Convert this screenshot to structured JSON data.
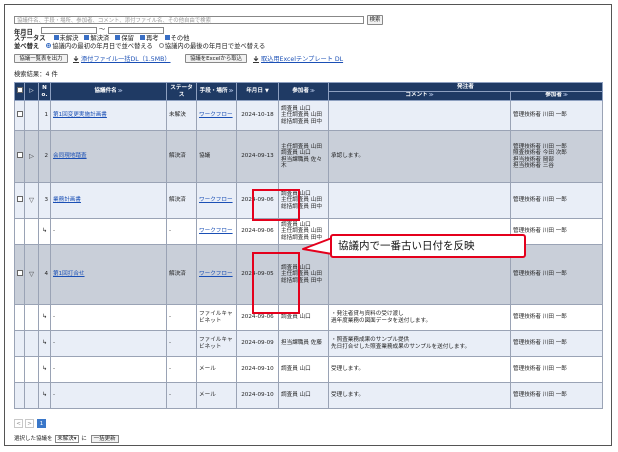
{
  "search": {
    "placeholder": "協議件名、手段・場所、参加者、コメント、添付ファイル名、その他自由で検索",
    "button": "検索"
  },
  "filters": {
    "year_label": "年月日",
    "range_sep": "～",
    "status_label": "ステータス",
    "status_options": [
      "未解決",
      "解決済",
      "保留",
      "再考",
      "その他"
    ],
    "sort_label": "並べ替え",
    "sort_options": [
      "協議内の最初の年月日で並べ替える",
      "協議内の最後の年月日で並べ替える"
    ]
  },
  "toolbar": {
    "print_button": "協議一覧表を出力",
    "attach_download": "添付ファイル一括DL（1.5MB）",
    "excel_import_button": "協議をExcelから取込",
    "excel_template": "取込用Excelテンプレート DL"
  },
  "result_count": "検索結果：4 件",
  "table": {
    "col_no": "No.",
    "col_title": "協議件名",
    "col_status": "ステータス",
    "col_method": "手段・場所",
    "col_date": "年月日",
    "col_participants": "参加者",
    "col_sender_group": "発注者",
    "col_comment": "コメント",
    "col_sender_participants": "参加者",
    "sort_mark": "≫",
    "date_sort_mark": "▼",
    "rows": [
      {
        "no": "1",
        "title": "第1回変更実施計画書",
        "status": "未解決",
        "method": "ワークフロー",
        "date": "2024-10-18",
        "participants": "調査員 山口\n主任調査員 山田\n総括調査員 田中",
        "comment": "",
        "sender": "管理技術者 川田 一郎"
      },
      {
        "no": "2",
        "title": "会同現地踏査",
        "status": "解決済",
        "method": "協議",
        "date": "2024-09-13",
        "participants": "主任調査員 山田\n調査員 山口\n担当課職員 佐々木",
        "comment": "承認します。",
        "sender": "管理技術者 川田 一郎\n照査技術者 今田 次郎\n担当技術者 岡部\n担当技術者 三谷"
      },
      {
        "no": "3",
        "title": "業務計画書",
        "status": "解決済",
        "method": "ワークフロー",
        "date": "2024-09-06",
        "participants": "調査員 山口\n主任調査員 山田\n総括調査員 田中",
        "comment": "",
        "sender": "管理技術者 川田 一郎"
      },
      {
        "no": "",
        "title": "-",
        "status": "-",
        "method": "ワークフロー",
        "date": "2024-09-06",
        "participants": "調査員 山口\n主任調査員 山田\n総括調査員 田中",
        "comment": "",
        "sender": "管理技術者 川田 一郎"
      },
      {
        "no": "4",
        "title": "第1回打合せ",
        "status": "解決済",
        "method": "ワークフロー",
        "date": "2024-09-05",
        "participants": "調査員 山口\n主任調査員 山田\n総括調査員 田中",
        "comment": "",
        "sender": "管理技術者 川田 一郎"
      },
      {
        "no": "",
        "title": "-",
        "status": "-",
        "method": "ファイルキャビネット",
        "date": "2024-09-06",
        "participants": "調査員 山口",
        "comment": "・発注者貸与資料の受け渡し\n過年度業務の図面データを送付します。",
        "sender": "管理技術者 川田 一郎"
      },
      {
        "no": "",
        "title": "-",
        "status": "-",
        "method": "ファイルキャビネット",
        "date": "2024-09-09",
        "participants": "担当課職員 佐藤",
        "comment": "・照査業務成果のサンプル提供\n先日打合せした照査業務成果のサンプルを送付します。",
        "sender": "管理技術者 川田 一郎"
      },
      {
        "no": "",
        "title": "-",
        "status": "-",
        "method": "メール",
        "date": "2024-09-10",
        "participants": "調査員 山口",
        "comment": "受理します。",
        "sender": "管理技術者 川田 一郎"
      },
      {
        "no": "",
        "title": "-",
        "status": "-",
        "method": "メール",
        "date": "2024-09-10",
        "participants": "調査員 山口",
        "comment": "受理します。",
        "sender": "管理技術者 川田 一郎"
      }
    ]
  },
  "annotation": "協議内で一番古い日付を反映",
  "pager": {
    "prev": "<",
    "next": ">",
    "page": "1"
  },
  "footer": {
    "label": "選択した協議を",
    "select_value": "未解決",
    "suffix": "に",
    "button": "一括更新"
  },
  "colors": {
    "header_bg": "#1f3a64",
    "highlight": "#e4001c",
    "row_gray": "#c9cfd9",
    "row_light": "#e9eef7"
  }
}
